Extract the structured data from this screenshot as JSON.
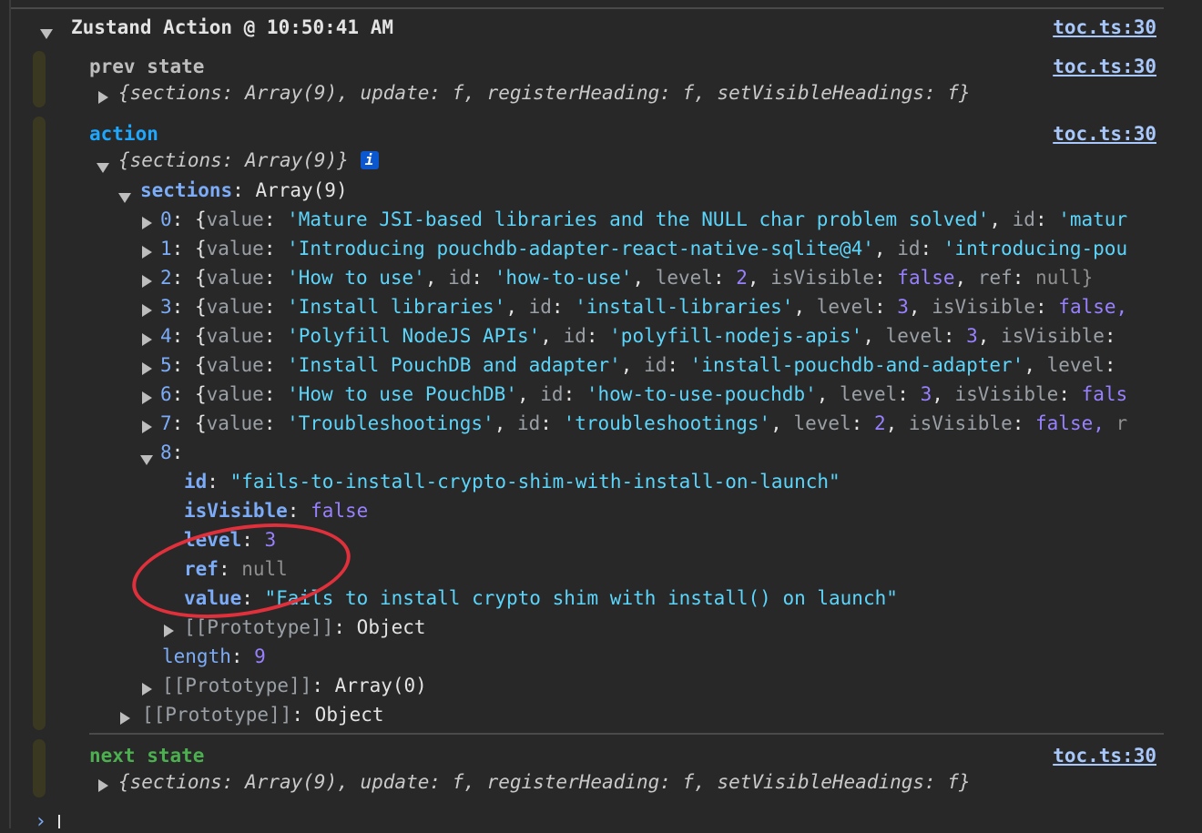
{
  "group": {
    "title": "Zustand Action @ 10:50:41 AM",
    "source_link": "toc.ts:30"
  },
  "prev_state": {
    "label": "prev state",
    "source_link": "toc.ts:30",
    "preview": "{sections: Array(9), update: f, registerHeading: f, setVisibleHeadings: f}"
  },
  "action": {
    "label": "action",
    "source_link": "toc.ts:30",
    "preview": "{sections: Array(9)}",
    "info_badge": "i",
    "sections_key": "sections",
    "sections_type": "Array(9)",
    "items": [
      {
        "index": "0",
        "value": "'Mature JSI-based libraries and the NULL char problem solved'",
        "id": "'matur"
      },
      {
        "index": "1",
        "value": "'Introducing pouchdb-adapter-react-native-sqlite@4'",
        "id": "'introducing-pou"
      },
      {
        "index": "2",
        "value": "'How to use'",
        "id": "'how-to-use'",
        "level": "2",
        "isVisible": "false",
        "ref": "null}"
      },
      {
        "index": "3",
        "value": "'Install libraries'",
        "id": "'install-libraries'",
        "level": "3",
        "isVisible": "false,"
      },
      {
        "index": "4",
        "value": "'Polyfill NodeJS APIs'",
        "id": "'polyfill-nodejs-apis'",
        "level": "3",
        "isVisible": ""
      },
      {
        "index": "5",
        "value": "'Install PouchDB and adapter'",
        "id": "'install-pouchdb-and-adapter'",
        "level": ""
      },
      {
        "index": "6",
        "value": "'How to use PouchDB'",
        "id": "'how-to-use-pouchdb'",
        "level": "3",
        "isVisible": "fals"
      },
      {
        "index": "7",
        "value": "'Troubleshootings'",
        "id": "'troubleshootings'",
        "level": "2",
        "isVisible": "false,",
        "ref": "r"
      }
    ],
    "expanded_item": {
      "index": "8",
      "id": "\"fails-to-install-crypto-shim-with-install-on-launch\"",
      "isVisible": "false",
      "level": "3",
      "ref": "null",
      "value": "\"Fails to install crypto shim with install() on launch\""
    },
    "item_proto": "[[Prototype]]",
    "item_proto_type": "Object",
    "length_key": "length",
    "length_value": "9",
    "array_proto": "[[Prototype]]",
    "array_proto_type": "Array(0)",
    "obj_proto": "[[Prototype]]",
    "obj_proto_type": "Object"
  },
  "next_state": {
    "label": "next state",
    "source_link": "toc.ts:30",
    "preview": "{sections: Array(9), update: f, registerHeading: f, setVisibleHeadings: f}"
  },
  "prompt": {
    "symbol": "›"
  },
  "colors": {
    "background": "#282828",
    "prev_state": "#bdbdbd",
    "action": "#1ea7fd",
    "next_state": "#4caf50",
    "annotation_ring": "#e0303b"
  }
}
